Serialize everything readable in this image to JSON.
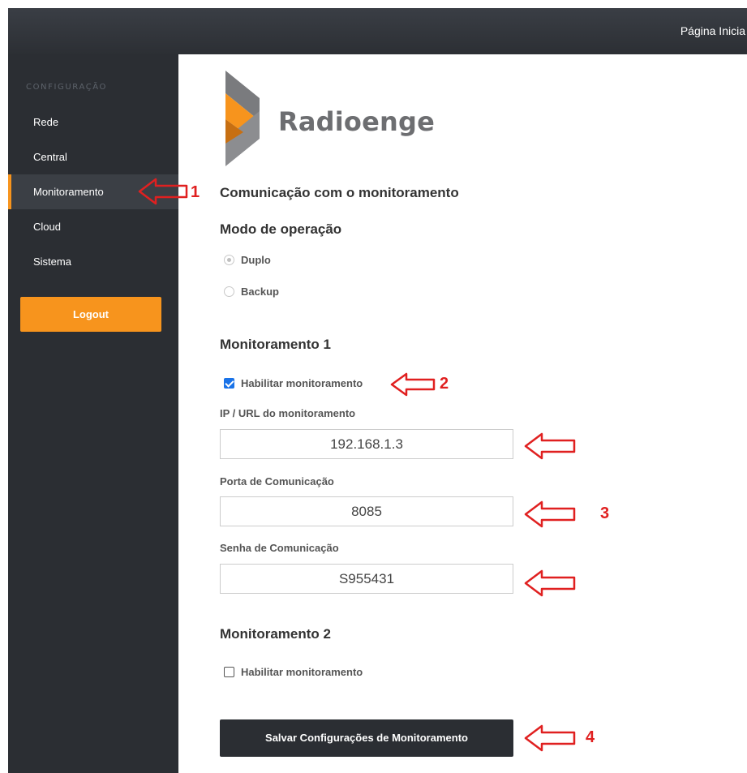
{
  "header": {
    "home_link": "Página Inicia"
  },
  "sidebar": {
    "section_title": "CONFIGURAÇÃO",
    "items": [
      {
        "label": "Rede",
        "active": false
      },
      {
        "label": "Central",
        "active": false
      },
      {
        "label": "Monitoramento",
        "active": true
      },
      {
        "label": "Cloud",
        "active": false
      },
      {
        "label": "Sistema",
        "active": false
      }
    ],
    "logout_label": "Logout"
  },
  "brand": {
    "name": "Radioenge",
    "colors": {
      "orange": "#f7941d",
      "gray": "#6d6e71"
    }
  },
  "main": {
    "title": "Comunicação com o monitoramento",
    "mode": {
      "title": "Modo de operação",
      "options": [
        {
          "label": "Duplo",
          "checked": true
        },
        {
          "label": "Backup",
          "checked": false
        }
      ]
    },
    "monitor1": {
      "title": "Monitoramento 1",
      "enable_label": "Habilitar monitoramento",
      "enabled": true,
      "ip_label": "IP / URL do monitoramento",
      "ip_value": "192.168.1.3",
      "port_label": "Porta de Comunicação",
      "port_value": "8085",
      "password_label": "Senha de Comunicação",
      "password_value": "S955431"
    },
    "monitor2": {
      "title": "Monitoramento 2",
      "enable_label": "Habilitar monitoramento",
      "enabled": false
    },
    "save_label": "Salvar Configurações de Monitoramento"
  },
  "annotations": {
    "n1": "1",
    "n2": "2",
    "n3": "3",
    "n4": "4",
    "color": "#e02020"
  }
}
